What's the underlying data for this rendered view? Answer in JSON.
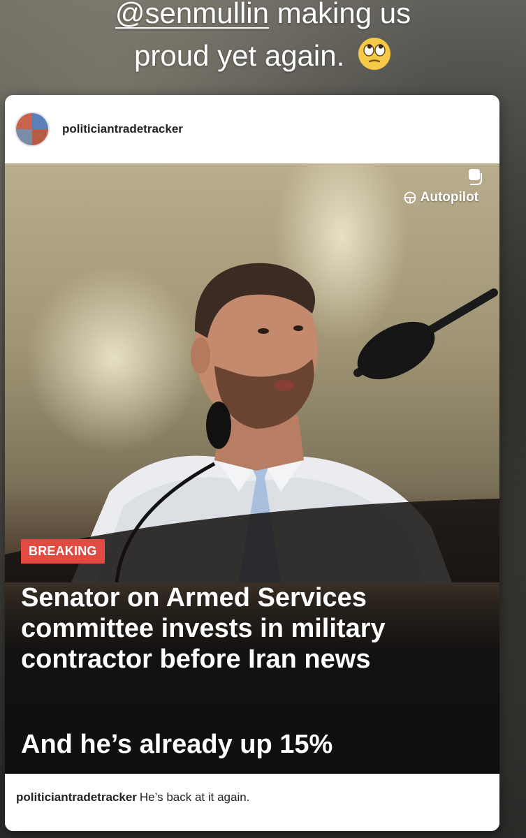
{
  "story": {
    "mention": "@senmullin",
    "caption_rest": " making us",
    "caption_line2": "proud yet again.",
    "emoji": "eye-roll-emoji"
  },
  "post": {
    "username": "politiciantradetracker",
    "watermark": "Autopilot",
    "badge": "BREAKING",
    "headline": "Senator on Armed Services committee invests in military contractor before Iran news",
    "subhead": "And he’s already up 15%",
    "caption_user": "politiciantradetracker",
    "caption_text": "He’s back at it again.",
    "colors": {
      "badge": "#e24b41",
      "headline_text": "#ffffff",
      "card_background": "#ffffff"
    }
  }
}
